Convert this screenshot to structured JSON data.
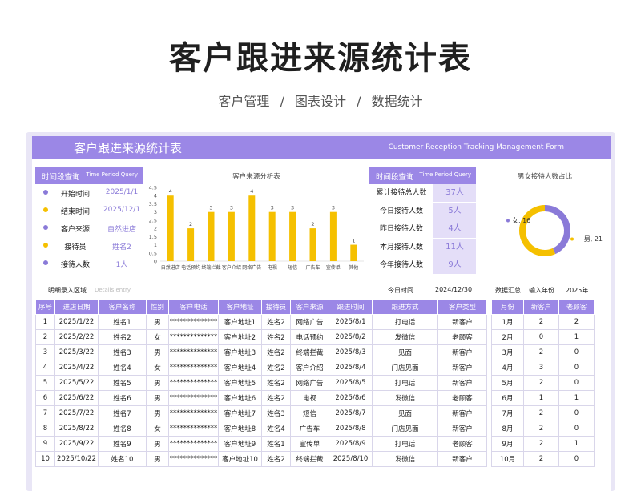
{
  "page": {
    "title": "客户跟进来源统计表",
    "subtitle": [
      "客户管理",
      "/",
      "图表设计",
      "/",
      "数据统计"
    ]
  },
  "sheet": {
    "banner_title": "客户跟进来源统计表",
    "banner_en": "Customer Reception Tracking Management Form",
    "query": {
      "header": "时间段查询",
      "header_en": "Time Period Query",
      "rows": [
        {
          "label": "开始时间",
          "value": "2025/1/1",
          "dot_color": "#8a7ad8"
        },
        {
          "label": "结束时间",
          "value": "2025/12/1",
          "dot_color": "#f5c000"
        },
        {
          "label": "客户来源",
          "value": "自然进店",
          "dot_color": "#8a7ad8"
        },
        {
          "label": "接待员",
          "value": "姓名2",
          "dot_color": "#f5c000"
        },
        {
          "label": "接待人数",
          "value": "1人",
          "dot_color": "#8a7ad8"
        }
      ]
    },
    "stats": {
      "header": "时间段查询",
      "header_en": "Time Period Query",
      "rows": [
        {
          "label": "累计接待总人数",
          "value": "37人"
        },
        {
          "label": "今日接待人数",
          "value": "5人"
        },
        {
          "label": "昨日接待人数",
          "value": "4人"
        },
        {
          "label": "本月接待人数",
          "value": "11人"
        },
        {
          "label": "今年接待人数",
          "value": "9人"
        }
      ]
    },
    "detail": {
      "label": "明细录入区域",
      "label_en": "Details entry",
      "today_label": "今日时间",
      "today_value": "2024/12/30",
      "columns": [
        "序号",
        "进店日期",
        "客户名称",
        "性别",
        "客户电话",
        "客户地址",
        "接待员",
        "客户来源",
        "跟进时间",
        "跟进方式",
        "客户类型"
      ],
      "rows": [
        [
          "1",
          "2025/1/22",
          "姓名1",
          "男",
          "**************",
          "客户地址1",
          "姓名2",
          "网络广告",
          "2025/8/1",
          "打电话",
          "新客户"
        ],
        [
          "2",
          "2025/2/22",
          "姓名2",
          "女",
          "**************",
          "客户地址2",
          "姓名2",
          "电话预约",
          "2025/8/2",
          "发微信",
          "老顾客"
        ],
        [
          "3",
          "2025/3/22",
          "姓名3",
          "男",
          "**************",
          "客户地址3",
          "姓名2",
          "终端拦截",
          "2025/8/3",
          "见面",
          "新客户"
        ],
        [
          "4",
          "2025/4/22",
          "姓名4",
          "女",
          "**************",
          "客户地址4",
          "姓名2",
          "客户介绍",
          "2025/8/4",
          "门店见面",
          "新客户"
        ],
        [
          "5",
          "2025/5/22",
          "姓名5",
          "男",
          "**************",
          "客户地址5",
          "姓名2",
          "网络广告",
          "2025/8/5",
          "打电话",
          "新客户"
        ],
        [
          "6",
          "2025/6/22",
          "姓名6",
          "男",
          "**************",
          "客户地址6",
          "姓名2",
          "电视",
          "2025/8/6",
          "发微信",
          "老顾客"
        ],
        [
          "7",
          "2025/7/22",
          "姓名7",
          "男",
          "**************",
          "客户地址7",
          "姓名3",
          "短信",
          "2025/8/7",
          "见面",
          "新客户"
        ],
        [
          "8",
          "2025/8/22",
          "姓名8",
          "女",
          "**************",
          "客户地址8",
          "姓名4",
          "广告车",
          "2025/8/8",
          "门店见面",
          "新客户"
        ],
        [
          "9",
          "2025/9/22",
          "姓名9",
          "男",
          "**************",
          "客户地址9",
          "姓名1",
          "宣传单",
          "2025/8/9",
          "打电话",
          "老顾客"
        ],
        [
          "10",
          "2025/10/22",
          "姓名10",
          "男",
          "**************",
          "客户地址10",
          "姓名2",
          "终端拦截",
          "2025/8/10",
          "发微信",
          "新客户"
        ]
      ]
    },
    "summary": {
      "label": "数据汇总",
      "year_label": "输入年份",
      "year_value": "2025年",
      "columns": [
        "月份",
        "新客户",
        "老顾客"
      ],
      "rows": [
        [
          "1月",
          "2",
          "2"
        ],
        [
          "2月",
          "0",
          "1"
        ],
        [
          "3月",
          "2",
          "0"
        ],
        [
          "4月",
          "3",
          "0"
        ],
        [
          "5月",
          "2",
          "0"
        ],
        [
          "6月",
          "1",
          "1"
        ],
        [
          "7月",
          "2",
          "0"
        ],
        [
          "8月",
          "2",
          "0"
        ],
        [
          "9月",
          "2",
          "1"
        ],
        [
          "10月",
          "2",
          "0"
        ]
      ]
    }
  },
  "chart_data": [
    {
      "type": "bar",
      "title": "客户来源分析表",
      "categories": [
        "自然进店",
        "电话预约",
        "终端拦截",
        "客户介绍",
        "网络广告",
        "电视",
        "短信",
        "广告车",
        "宣传单",
        "其他"
      ],
      "values": [
        4,
        2,
        3,
        3,
        4,
        3,
        3,
        2,
        3,
        1
      ],
      "yticks": [
        "0",
        "0.5",
        "1",
        "1.5",
        "2",
        "2.5",
        "3",
        "3.5",
        "4",
        "4.5"
      ],
      "ylim": [
        0,
        4.5
      ],
      "bar_color": "#f5c000",
      "grid": false
    },
    {
      "type": "pie",
      "title": "男女接待人数占比",
      "labels": [
        "女",
        "男"
      ],
      "values": [
        16,
        21
      ],
      "label_text": [
        "女, 16",
        "男, 21"
      ],
      "colors": [
        "#8a7ad8",
        "#f5c000"
      ],
      "donut": true
    }
  ]
}
